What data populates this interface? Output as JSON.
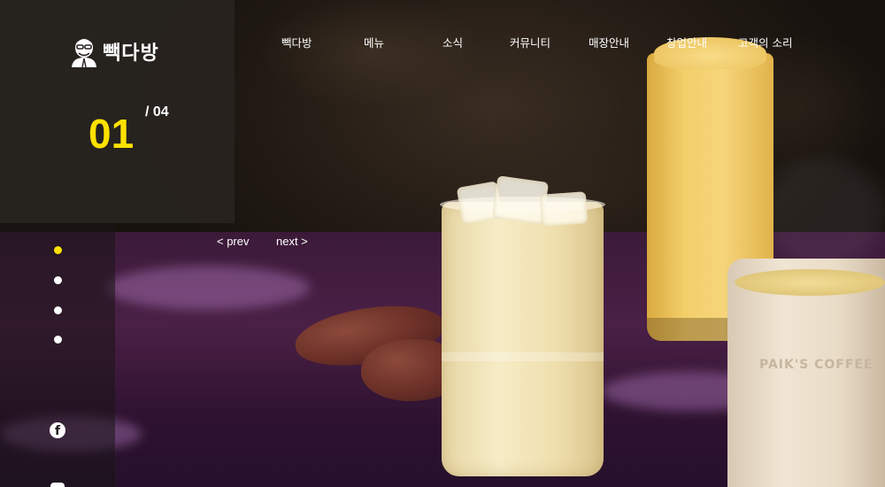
{
  "brand": {
    "name": "빽다방",
    "accent_color": "#ffe100"
  },
  "nav": {
    "items": [
      {
        "label": "빽다방"
      },
      {
        "label": "메뉴"
      },
      {
        "label": "소식"
      },
      {
        "label": "커뮤니티"
      },
      {
        "label": "매장안내"
      },
      {
        "label": "창업안내"
      },
      {
        "label": "고객의 소리"
      }
    ]
  },
  "slider": {
    "current": "01",
    "total_label": "/ 04",
    "prev_label": "< prev",
    "next_label": "next >",
    "dots_count": 4,
    "active_dot": 1
  },
  "hero": {
    "cup_print": "PAIK'S COFFEE"
  },
  "social": {
    "items": [
      {
        "icon": "facebook-icon",
        "glyph": "f"
      },
      {
        "icon": "social-icon"
      }
    ]
  }
}
